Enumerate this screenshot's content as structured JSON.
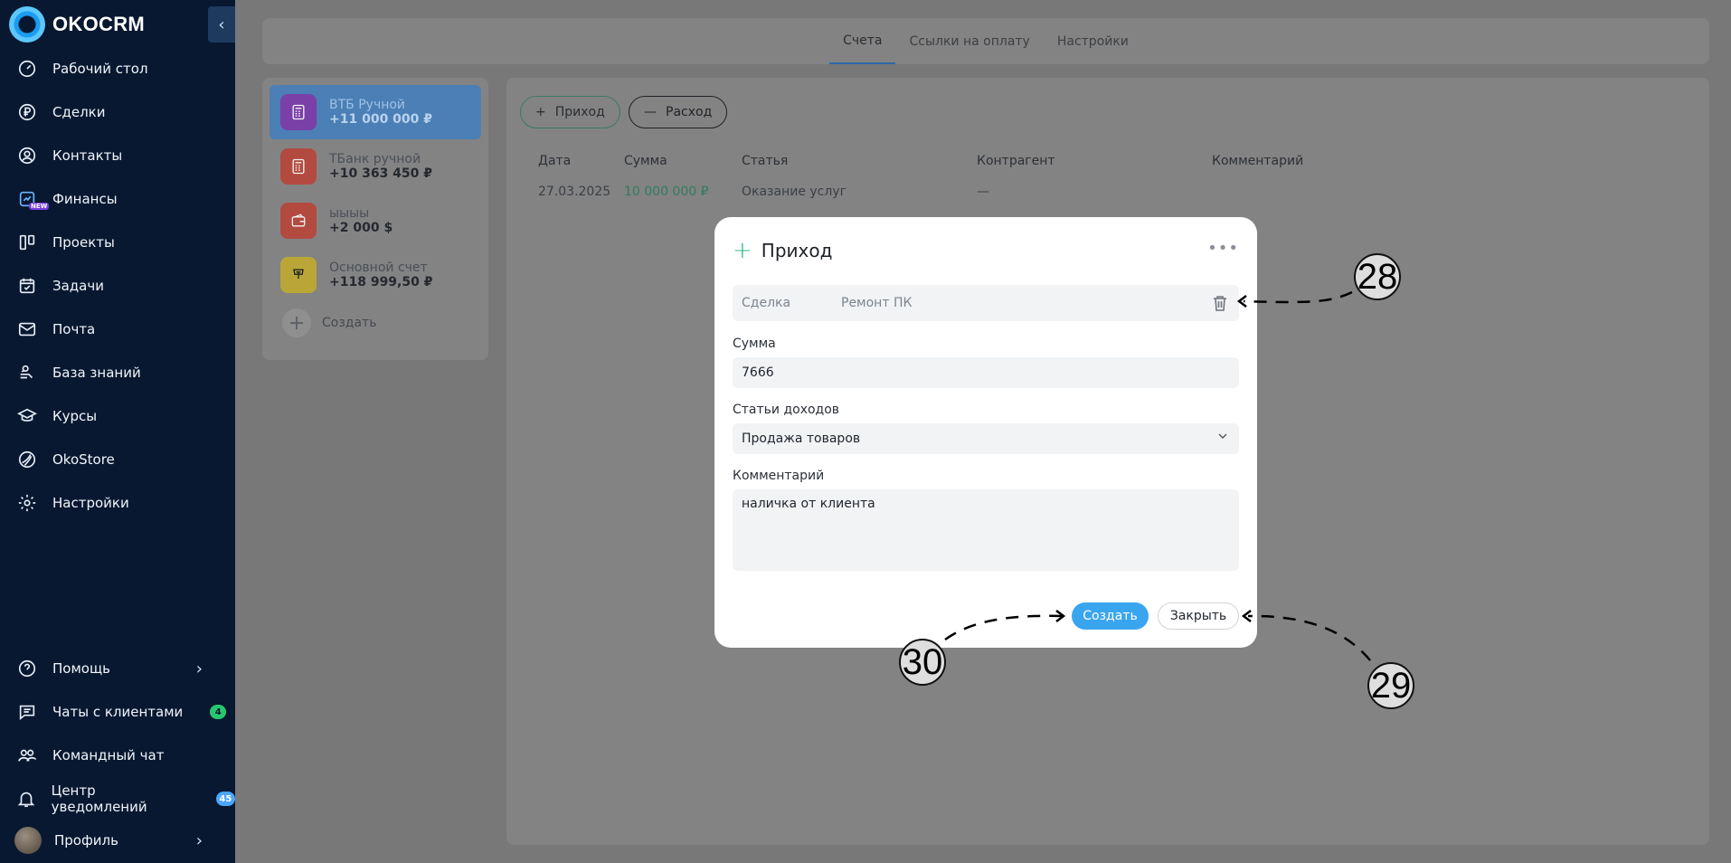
{
  "app": {
    "logo_text": "OKOCRM"
  },
  "sidebar": {
    "items": [
      {
        "label": "Рабочий стол",
        "icon": "dashboard-icon"
      },
      {
        "label": "Сделки",
        "icon": "ruble-icon"
      },
      {
        "label": "Контакты",
        "icon": "contact-icon"
      },
      {
        "label": "Финансы",
        "icon": "finance-icon",
        "tag": "NEW"
      },
      {
        "label": "Проекты",
        "icon": "projects-icon"
      },
      {
        "label": "Задачи",
        "icon": "calendar-check-icon"
      },
      {
        "label": "Почта",
        "icon": "mail-icon"
      },
      {
        "label": "База знаний",
        "icon": "knowledge-icon"
      },
      {
        "label": "Курсы",
        "icon": "graduation-icon"
      },
      {
        "label": "OkoStore",
        "icon": "store-icon"
      },
      {
        "label": "Настройки",
        "icon": "gear-icon"
      }
    ],
    "bottom": [
      {
        "label": "Помощь",
        "icon": "help-icon"
      },
      {
        "label": "Чаты с клиентами",
        "icon": "chat-icon",
        "badge": "4"
      },
      {
        "label": "Командный чат",
        "icon": "team-icon"
      },
      {
        "label": "Центр уведомлений",
        "icon": "bell-icon",
        "badge": "45"
      },
      {
        "label": "Профиль",
        "icon": "avatar"
      }
    ]
  },
  "tabs": [
    "Счета",
    "Ссылки на оплату",
    "Настройки"
  ],
  "accounts": [
    {
      "name": "ВТБ Ручной",
      "sum": "+11 000 000 ₽",
      "color": "#7b3fa8"
    },
    {
      "name": "ТБанк ручной",
      "sum": "+10 363 450 ₽",
      "color": "#b34a40"
    },
    {
      "name": "ыыыы",
      "sum": "+2 000 $",
      "color": "#b34a40"
    },
    {
      "name": "Основной счет",
      "sum": "+118 999,50 ₽",
      "color": "#b9a637"
    }
  ],
  "accounts_create": "Создать",
  "actions": {
    "income": "Приход",
    "expense": "Расход"
  },
  "table": {
    "headers": [
      "Дата",
      "Сумма",
      "Статья",
      "Контрагент",
      "Комментарий"
    ],
    "rows": [
      [
        "27.03.2025",
        "10 000 000 ₽",
        "Оказание услуг",
        "—",
        ""
      ]
    ]
  },
  "modal": {
    "title": "Приход",
    "deal_label": "Сделка",
    "deal_value": "Ремонт ПК",
    "sum_label": "Сумма",
    "sum_value": "7666",
    "category_label": "Статьи доходов",
    "category_value": "Продажа товаров",
    "comment_label": "Комментарий",
    "comment_value": "наличка от клиента",
    "create_button": "Создать",
    "close_button": "Закрыть"
  },
  "annotations": [
    "28",
    "29",
    "30"
  ],
  "colors": {
    "accent": "#3aa5ef",
    "income_green": "#2bb88a",
    "sidebar_bg": "#081830"
  }
}
